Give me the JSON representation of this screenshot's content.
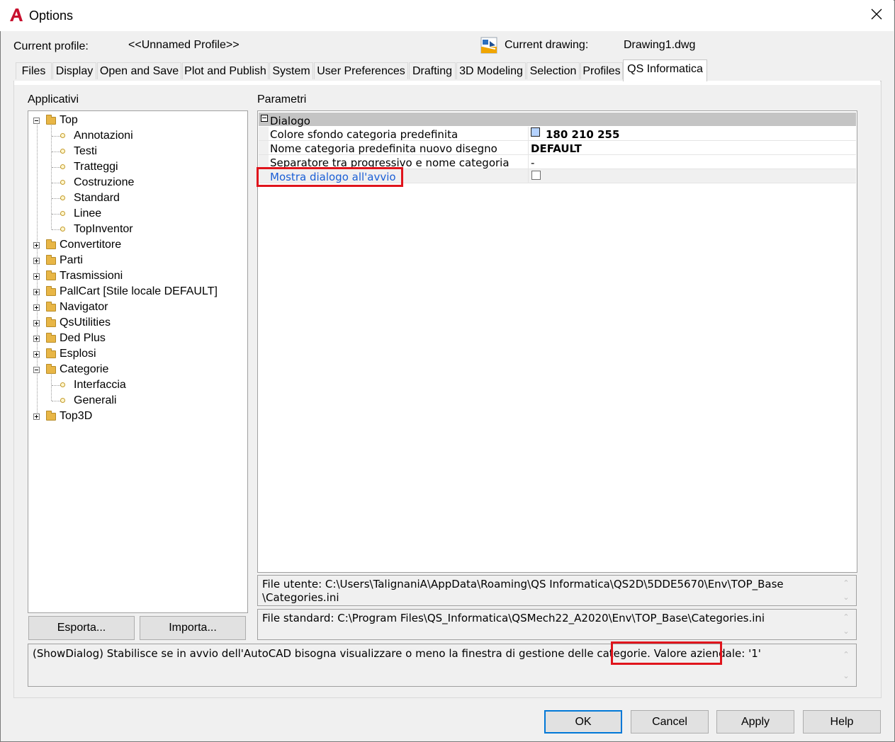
{
  "window": {
    "title": "Options"
  },
  "profile": {
    "current_profile_label": "Current profile:",
    "current_profile_value": "<<Unnamed Profile>>",
    "current_drawing_label": "Current drawing:",
    "current_drawing_value": "Drawing1.dwg"
  },
  "tabs": [
    {
      "label": "Files"
    },
    {
      "label": "Display"
    },
    {
      "label": "Open and Save"
    },
    {
      "label": "Plot and Publish"
    },
    {
      "label": "System"
    },
    {
      "label": "User Preferences"
    },
    {
      "label": "Drafting"
    },
    {
      "label": "3D Modeling"
    },
    {
      "label": "Selection"
    },
    {
      "label": "Profiles"
    },
    {
      "label": "QS Informatica"
    }
  ],
  "active_tab": "QS Informatica",
  "tree": {
    "label": "Applicativi",
    "nodes": [
      {
        "label": "Top"
      },
      {
        "label": "Annotazioni"
      },
      {
        "label": "Testi"
      },
      {
        "label": "Tratteggi"
      },
      {
        "label": "Costruzione"
      },
      {
        "label": "Standard"
      },
      {
        "label": "Linee"
      },
      {
        "label": "TopInventor"
      },
      {
        "label": "Convertitore"
      },
      {
        "label": "Parti"
      },
      {
        "label": "Trasmissioni"
      },
      {
        "label": "PallCart [Stile locale DEFAULT]"
      },
      {
        "label": "Navigator"
      },
      {
        "label": "QsUtilities"
      },
      {
        "label": "Ded Plus"
      },
      {
        "label": "Esplosi"
      },
      {
        "label": "Categorie"
      },
      {
        "label": "Interfaccia"
      },
      {
        "label": "Generali"
      },
      {
        "label": "Top3D"
      }
    ]
  },
  "buttons": {
    "export": "Esporta...",
    "import": "Importa...",
    "ok": "OK",
    "cancel": "Cancel",
    "apply": "Apply",
    "help": "Help"
  },
  "params": {
    "label": "Parametri",
    "category": "Dialogo",
    "rows": [
      {
        "name": "Colore sfondo categoria predefinita",
        "value": "180 210 255",
        "swatch": "#b4d2ff"
      },
      {
        "name": "Nome categoria predefinita nuovo disegno",
        "value": "DEFAULT"
      },
      {
        "name": "Separatore tra progressivo e nome categoria",
        "value": "-"
      },
      {
        "name": "Mostra dialogo all'avvio",
        "value": "",
        "checked": false
      }
    ]
  },
  "files": {
    "user_file_line1": "File utente: C:\\Users\\TalignaniA\\AppData\\Roaming\\QS Informatica\\QS2D\\5DDE5670\\Env\\TOP_Base",
    "user_file_line2": "\\Categories.ini",
    "standard_file": "File standard: C:\\Program Files\\QS_Informatica\\QSMech22_A2020\\Env\\TOP_Base\\Categories.ini"
  },
  "description": {
    "text": "(ShowDialog) Stabilisce se in avvio dell'AutoCAD bisogna visualizzare o meno la finestra di gestione delle categorie.",
    "company_value": "Valore aziendale: '1'"
  },
  "colors": {
    "accent": "#0078d7",
    "highlight": "#e0141c",
    "link": "#1a5fd6",
    "brand_red": "#c8102e"
  }
}
